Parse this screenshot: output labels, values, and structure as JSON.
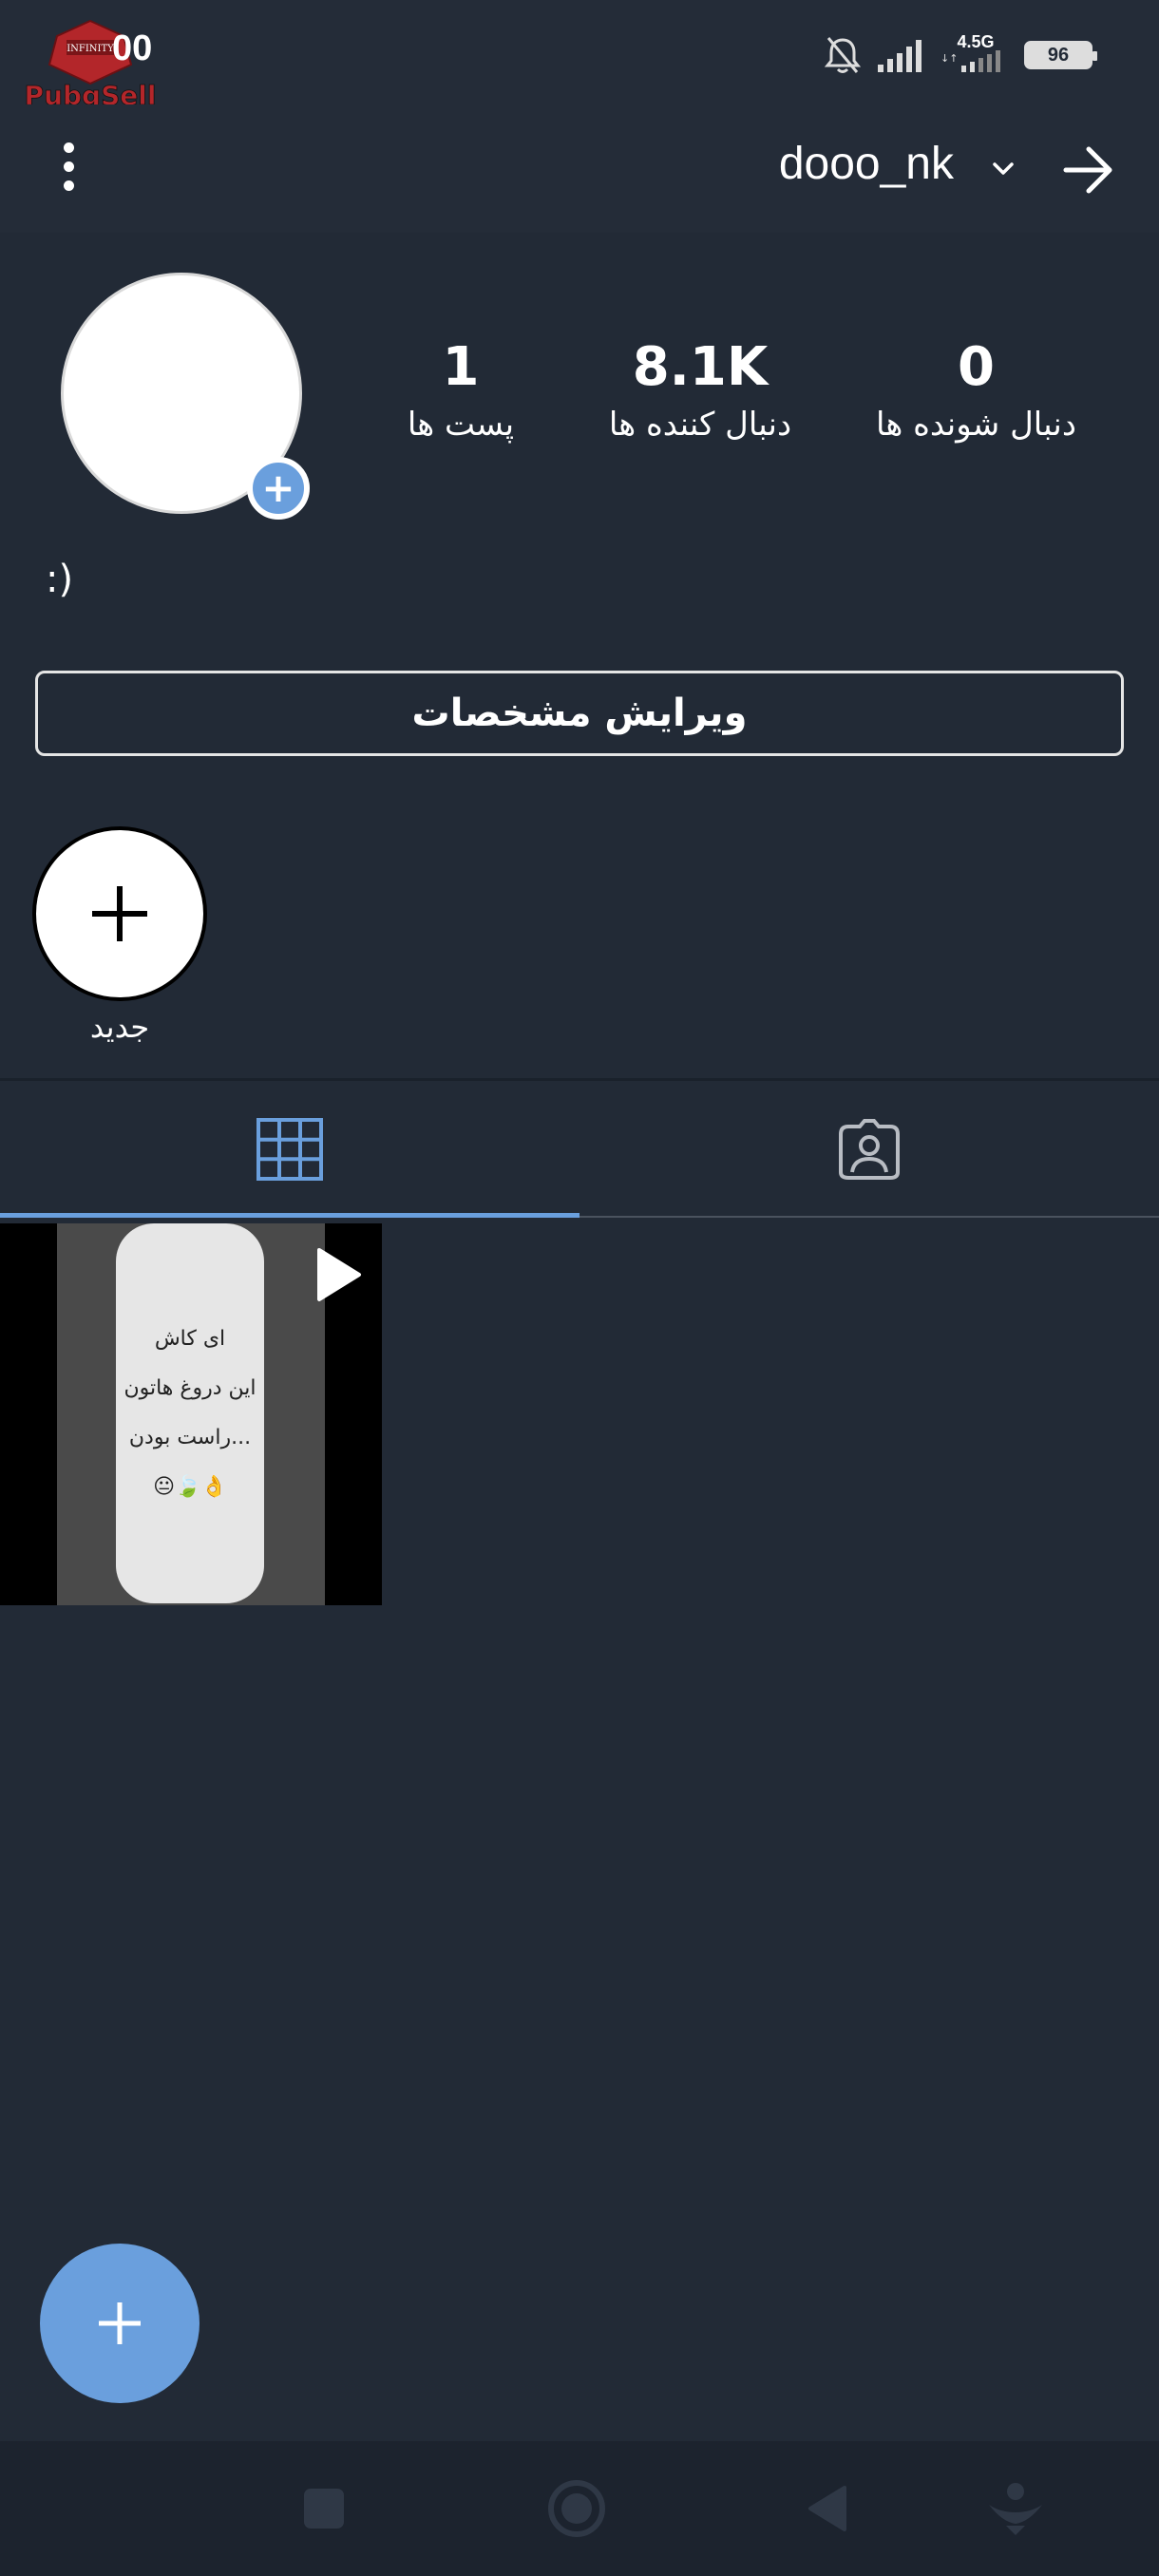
{
  "status_bar": {
    "clock": "00",
    "watermark_text": "PubgSell",
    "watermark_badge": "INFINITY",
    "network": "4.5G",
    "battery": "96"
  },
  "app_bar": {
    "username": "dooo_nk"
  },
  "profile": {
    "stats": [
      {
        "count": "1",
        "label": "پست ها"
      },
      {
        "count": "8.1K",
        "label": "دنبال کننده ها"
      },
      {
        "count": "0",
        "label": "دنبال شونده ها"
      }
    ],
    "bio": ":)"
  },
  "edit_profile_label": "ویرایش مشخصات",
  "story_highlight": {
    "new_label": "جدید"
  },
  "tabs": {
    "active": "posts-grid"
  },
  "posts": [
    {
      "type": "video",
      "lines": [
        "ای کاش",
        "این دروغ هاتون",
        "راست بودن...",
        "😐🍃👌"
      ]
    }
  ],
  "colors": {
    "background": "#222a36",
    "accent": "#6a9fdd",
    "nav_bar": "#1c232e"
  }
}
